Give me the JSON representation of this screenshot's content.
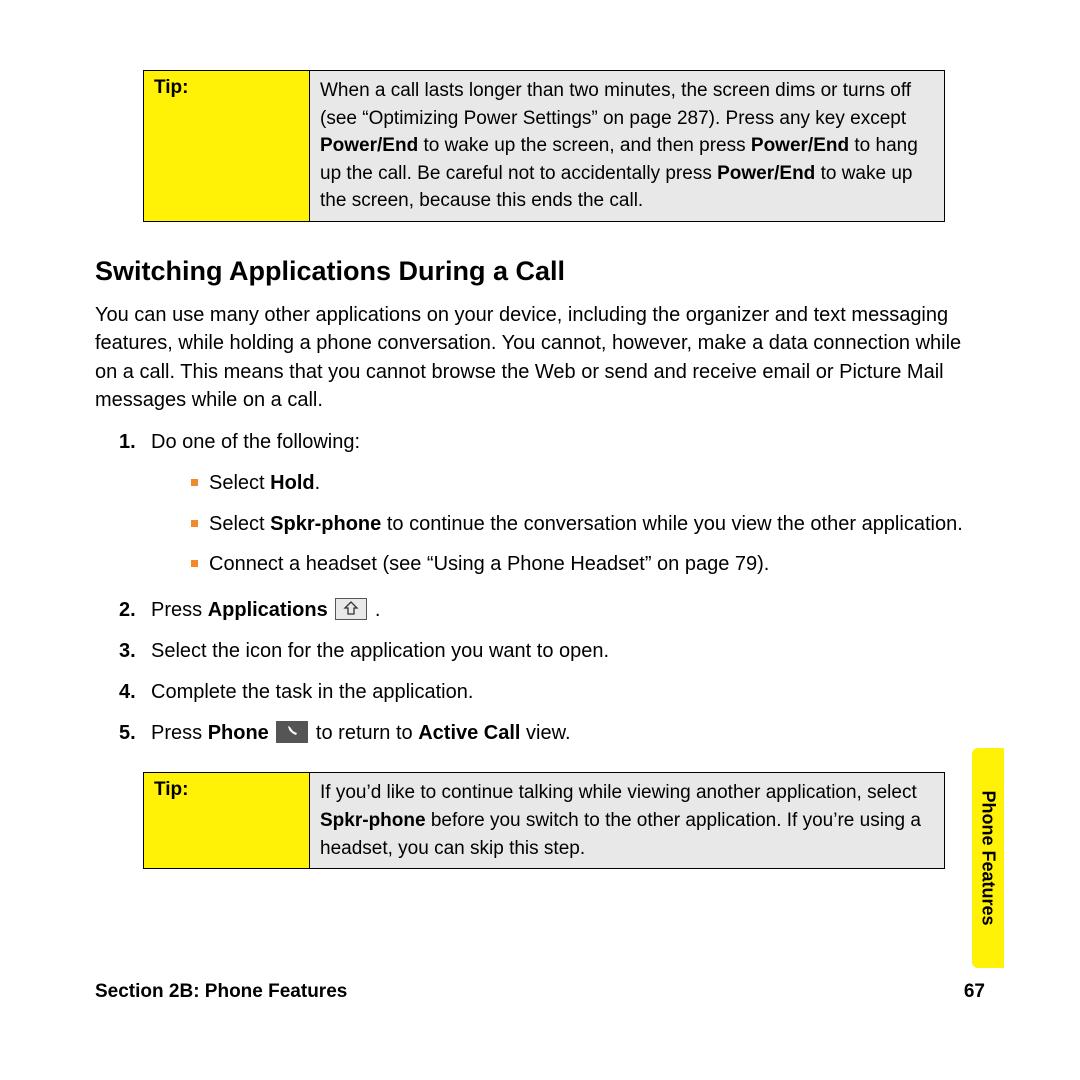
{
  "tips": [
    {
      "label": "Tip:",
      "body_parts": [
        "When a call lasts longer than two minutes, the screen dims or turns off (see “Optimizing Power Settings” on page 287). Press any key except ",
        "Power/End",
        " to wake up the screen, and then press ",
        "Power/End",
        " to hang up the call. Be careful not to accidentally press ",
        "Power/End",
        " to wake up the screen, because this ends the call."
      ]
    },
    {
      "label": "Tip:",
      "body_parts": [
        "If you’d like to continue talking while viewing another application, select ",
        "Spkr-phone",
        " before you switch to the other application. If you’re using a headset, you can skip this step."
      ]
    }
  ],
  "heading": "Switching Applications During a Call",
  "intro": "You can use many other applications on your device, including the organizer and text messaging features, while holding a phone conversation. You cannot, however, make a data connection while on a call. This means that you cannot browse the Web or send and receive email or Picture Mail messages while on a call.",
  "steps": {
    "s1": {
      "num": "1.",
      "text": "Do one of the following:",
      "sub": {
        "a_pre": "Select ",
        "a_bold": "Hold",
        "a_post": ".",
        "b_pre": "Select ",
        "b_bold": "Spkr-phone",
        "b_post": " to continue the conversation while you view the other application.",
        "c": "Connect a headset (see “Using a Phone Headset” on page 79)."
      }
    },
    "s2": {
      "num": "2.",
      "pre": "Press ",
      "bold": "Applications",
      "post": " ."
    },
    "s3": {
      "num": "3.",
      "text": "Select the icon for the application you want to open."
    },
    "s4": {
      "num": "4.",
      "text": "Complete the task in the application."
    },
    "s5": {
      "num": "5.",
      "pre": "Press ",
      "bold": "Phone",
      "mid": "  to return to ",
      "bold2": "Active Call",
      "post": " view."
    }
  },
  "footer": {
    "section": "Section 2B: Phone Features",
    "page": "67"
  },
  "side_tab": "Phone Features"
}
